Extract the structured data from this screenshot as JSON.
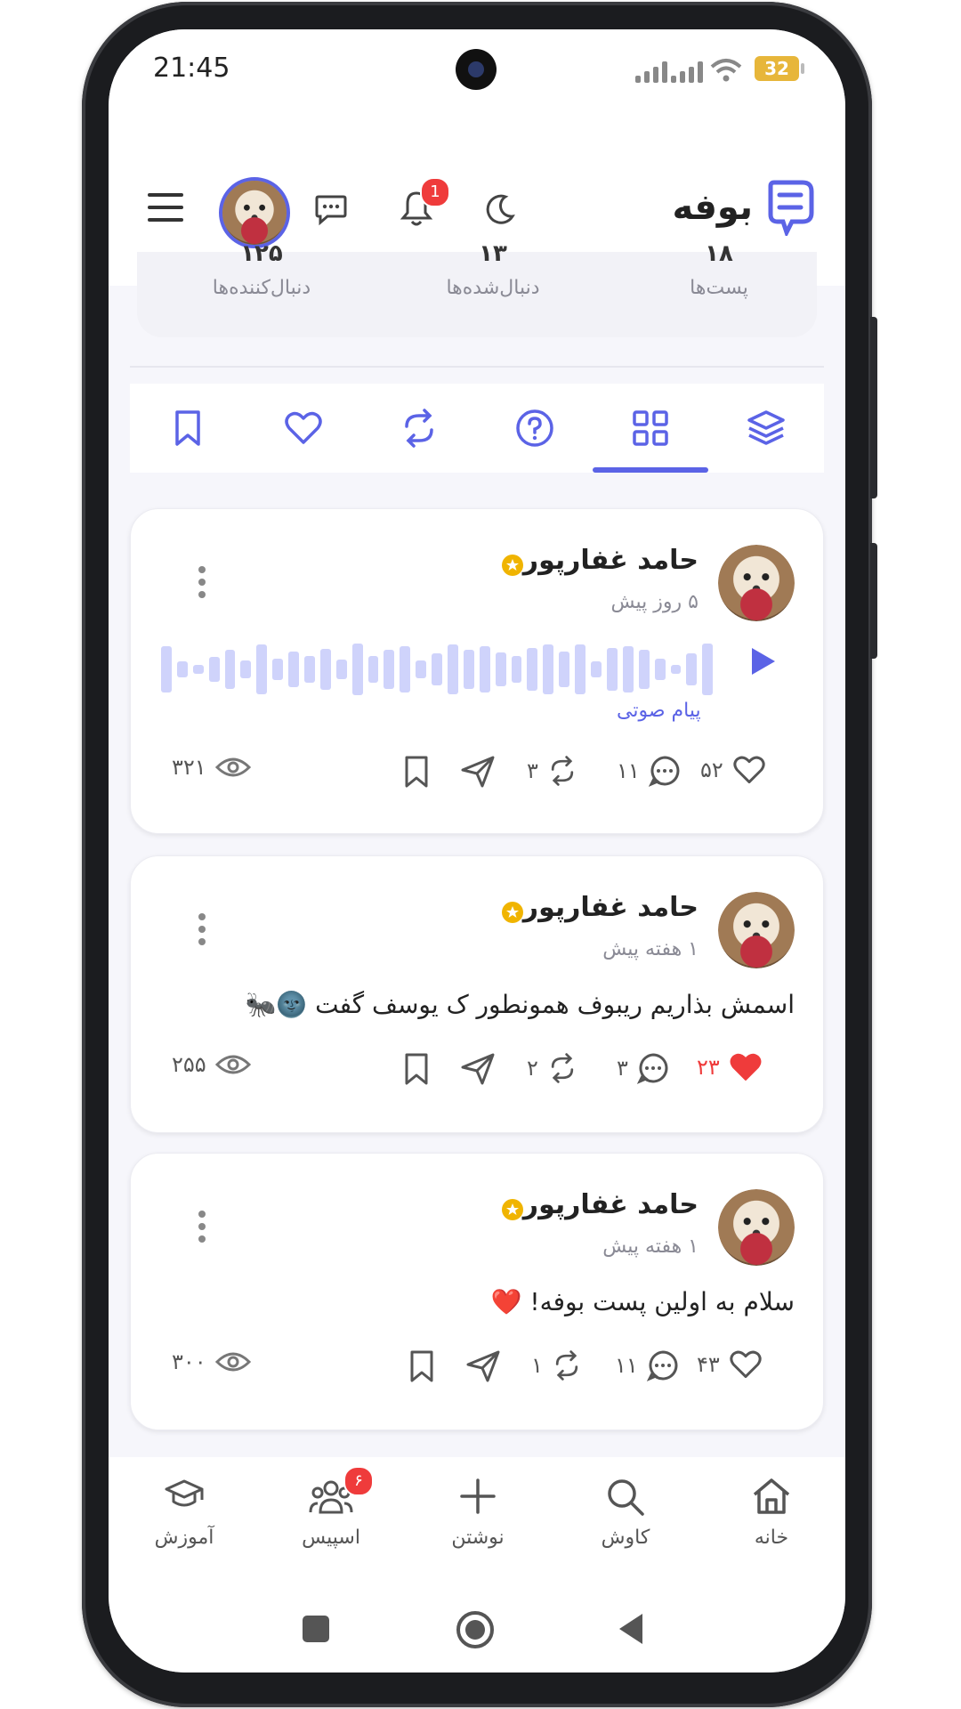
{
  "status_bar": {
    "time": "21:45",
    "battery": "32"
  },
  "header": {
    "brand": "بوفه",
    "notification_count": "1"
  },
  "stats": [
    {
      "value": "۱۸",
      "label": "پست‌ها"
    },
    {
      "value": "۱۳",
      "label": "دنبال‌شده‌ها"
    },
    {
      "value": "۱۲۵",
      "label": "دنبال‌کننده‌ها"
    }
  ],
  "tabs": [
    "layers-icon",
    "grid-icon",
    "question-icon",
    "repost-icon",
    "heart-icon",
    "bookmark-icon"
  ],
  "active_tab": "grid-icon",
  "posts": [
    {
      "author": "حامد غفارپور",
      "time": "۵ روز پیش",
      "voice_label": "پیام صوتی",
      "likes": "۵۲",
      "comments": "۱۱",
      "reposts": "۳",
      "views": "۳۲۱",
      "liked": false
    },
    {
      "author": "حامد غفارپور",
      "time": "۱ هفته پیش",
      "text": "اسمش بذاریم ریبوف همونطور ک یوسف گفت 🌚🐜",
      "likes": "۲۳",
      "comments": "۳",
      "reposts": "۲",
      "views": "۲۵۵",
      "liked": true
    },
    {
      "author": "حامد غفارپور",
      "time": "۱ هفته پیش",
      "text": "سلام به اولین پست بوفه! ❤️",
      "likes": "۴۳",
      "comments": "۱۱",
      "reposts": "۱",
      "views": "۳۰۰",
      "liked": false
    }
  ],
  "bottom_nav": [
    {
      "label": "خانه",
      "icon": "home-icon"
    },
    {
      "label": "کاوش",
      "icon": "search-icon"
    },
    {
      "label": "نوشتن",
      "icon": "plus-icon"
    },
    {
      "label": "اسپیس",
      "icon": "users-icon",
      "badge": "۶"
    },
    {
      "label": "آموزش",
      "icon": "graduation-cap-icon"
    }
  ],
  "colors": {
    "accent": "#5b63e6",
    "like_red": "#ef3b3b",
    "verified": "#f0b400"
  }
}
